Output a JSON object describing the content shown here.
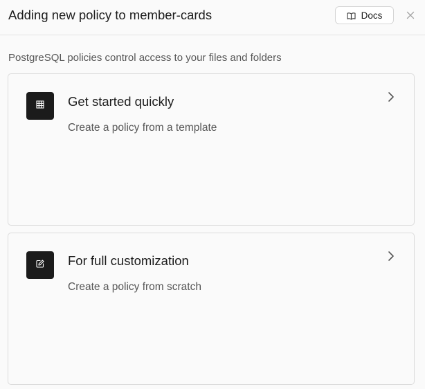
{
  "dialog": {
    "title": "Adding new policy to member-cards",
    "docs_label": "Docs",
    "subtitle": "PostgreSQL policies control access to your files and folders"
  },
  "cards": [
    {
      "title": "Get started quickly",
      "description": "Create a policy from a template",
      "icon": "grid-icon"
    },
    {
      "title": "For full customization",
      "description": "Create a policy from scratch",
      "icon": "edit-icon"
    }
  ],
  "colors": {
    "background": "#fafafa",
    "icon_tile": "#1b1b1b",
    "border": "#dcdcdc",
    "muted_text": "#565656"
  }
}
